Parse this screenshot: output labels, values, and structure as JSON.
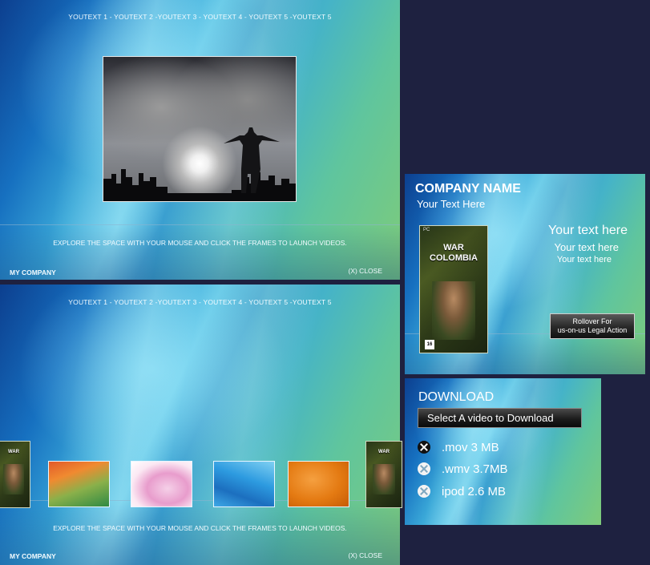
{
  "top_panel": {
    "nav": "YOUTEXT 1 - YOUTEXT 2 -YOUTEXT 3 - YOUTEXT 4 - YOUTEXT 5 -YOUTEXT 5",
    "explore": "EXPLORE THE SPACE WITH YOUR MOUSE AND CLICK THE FRAMES TO LAUNCH VIDEOS.",
    "company": "MY COMPANY",
    "close": "(X) CLOSE"
  },
  "bottom_panel": {
    "nav": "YOUTEXT 1 - YOUTEXT 2 -YOUTEXT 3 - YOUTEXT 4 - YOUTEXT 5 -YOUTEXT 5",
    "explore": "EXPLORE THE SPACE WITH YOUR MOUSE AND CLICK THE FRAMES TO LAUNCH VIDEOS.",
    "company": "MY COMPANY",
    "close": "(X) CLOSE"
  },
  "company_card": {
    "title": "COMPANY NAME",
    "subtitle": "Your Text Here",
    "line1": "Your text here",
    "line2": "Your text here",
    "line3": "Your text here",
    "rollover_line1": "Rollover For",
    "rollover_line2": "us-on-us Legal Action"
  },
  "game_box": {
    "title_line1": "WAR",
    "title_line2": "COLOMBIA",
    "platform": "PC",
    "rating": "16"
  },
  "download": {
    "title": "DOWNLOAD",
    "select_label": "Select A video to Download",
    "items": [
      {
        "label": ".mov 3 MB",
        "icon": "dark"
      },
      {
        "label": ".wmv 3.7MB",
        "icon": "light"
      },
      {
        "label": "ipod 2.6 MB",
        "icon": "light"
      }
    ]
  }
}
